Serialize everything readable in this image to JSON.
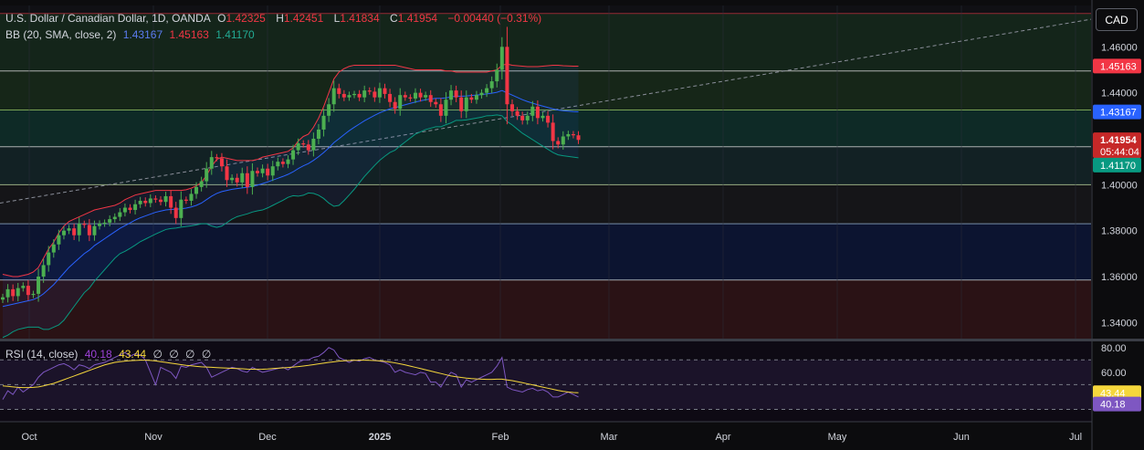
{
  "header": {
    "symbol": "U.S. Dollar / Canadian Dollar, 1D, OANDA",
    "open_label": "O",
    "open": "1.42325",
    "high_label": "H",
    "high": "1.42451",
    "low_label": "L",
    "low": "1.41834",
    "close_label": "C",
    "close": "1.41954",
    "change": "−0.00440 (−0.31%)"
  },
  "bb_legend": {
    "label": "BB (20, SMA, close, 2)",
    "basis": "1.43167",
    "upper": "1.45163",
    "lower": "1.41170"
  },
  "rsi_legend": {
    "label": "RSI (14, close)",
    "rsi": "40.18",
    "ma": "43.44",
    "extras": [
      "∅",
      "∅",
      "∅",
      "∅"
    ]
  },
  "currency_button": "CAD",
  "price_badges": {
    "upper": "1.45163",
    "basis": "1.43167",
    "last": "1.41954",
    "countdown": "05:44:04",
    "lower": "1.41170"
  },
  "rsi_badges": {
    "ma": "43.44",
    "rsi": "40.18"
  },
  "colors": {
    "up": "#4caf50",
    "down": "#f23645",
    "bb_upper": "#f23645",
    "bb_basis": "#2962ff",
    "bb_lower": "#089981",
    "rsi": "#7e57c2",
    "rsi_ma": "#f5d73c"
  },
  "chart_data": [
    {
      "type": "candlestick",
      "title": "U.S. Dollar / Canadian Dollar, 1D, OANDA",
      "x_ticks": [
        "Oct",
        "Nov",
        "Dec",
        "2025",
        "Feb",
        "Mar",
        "Apr",
        "May",
        "Jun",
        "Jul"
      ],
      "y_ticks": [
        "1.46000",
        "1.44000",
        "1.40000",
        "1.38000",
        "1.36000",
        "1.34000"
      ],
      "ylim": [
        1.333,
        1.478
      ],
      "levels": [
        1.4745,
        1.4495,
        1.4325,
        1.4165,
        1.4,
        1.383,
        1.3585
      ],
      "closes": [
        1.351,
        1.3545,
        1.3515,
        1.355,
        1.356,
        1.352,
        1.3525,
        1.36,
        1.365,
        1.3705,
        1.374,
        1.378,
        1.38,
        1.381,
        1.378,
        1.383,
        1.3825,
        1.378,
        1.382,
        1.383,
        1.3835,
        1.385,
        1.386,
        1.388,
        1.39,
        1.389,
        1.3915,
        1.393,
        1.392,
        1.394,
        1.3935,
        1.3925,
        1.395,
        1.39,
        1.3855,
        1.3935,
        1.393,
        1.396,
        1.399,
        1.4015,
        1.407,
        1.412,
        1.4115,
        1.408,
        1.402,
        1.403,
        1.401,
        1.405,
        1.399,
        1.406,
        1.405,
        1.407,
        1.404,
        1.408,
        1.41,
        1.409,
        1.411,
        1.415,
        1.418,
        1.4175,
        1.415,
        1.42,
        1.424,
        1.43,
        1.435,
        1.442,
        1.4395,
        1.438,
        1.439,
        1.4395,
        1.438,
        1.441,
        1.4405,
        1.438,
        1.442,
        1.4395,
        1.436,
        1.433,
        1.439,
        1.438,
        1.4375,
        1.44,
        1.438,
        1.439,
        1.436,
        1.435,
        1.43,
        1.437,
        1.441,
        1.438,
        1.432,
        1.438,
        1.437,
        1.439,
        1.44,
        1.442,
        1.445,
        1.45,
        1.46,
        1.435,
        1.432,
        1.43,
        1.428,
        1.43,
        1.434,
        1.429,
        1.43,
        1.427,
        1.419,
        1.4175,
        1.421,
        1.422,
        1.4215,
        1.4195
      ],
      "bb_upper": [
        1.361,
        1.3605,
        1.36,
        1.36,
        1.3605,
        1.361,
        1.362,
        1.364,
        1.368,
        1.372,
        1.375,
        1.379,
        1.382,
        1.384,
        1.385,
        1.386,
        1.387,
        1.388,
        1.389,
        1.3895,
        1.39,
        1.3905,
        1.391,
        1.392,
        1.3935,
        1.3945,
        1.3955,
        1.396,
        1.3965,
        1.397,
        1.3975,
        1.3975,
        1.3975,
        1.3975,
        1.3975,
        1.3975,
        1.3978,
        1.3985,
        1.3995,
        1.401,
        1.404,
        1.408,
        1.411,
        1.412,
        1.4115,
        1.411,
        1.4105,
        1.4105,
        1.4105,
        1.4105,
        1.411,
        1.412,
        1.4125,
        1.413,
        1.4135,
        1.414,
        1.4145,
        1.416,
        1.419,
        1.421,
        1.422,
        1.425,
        1.429,
        1.434,
        1.44,
        1.446,
        1.449,
        1.4505,
        1.4515,
        1.452,
        1.452,
        1.452,
        1.452,
        1.452,
        1.452,
        1.452,
        1.452,
        1.452,
        1.4515,
        1.451,
        1.4505,
        1.45,
        1.45,
        1.45,
        1.45,
        1.45,
        1.45,
        1.4495,
        1.4495,
        1.449,
        1.449,
        1.449,
        1.449,
        1.449,
        1.449,
        1.449,
        1.4495,
        1.45,
        1.452,
        1.4525,
        1.452,
        1.4518,
        1.4516,
        1.4514,
        1.4514,
        1.4514,
        1.4516,
        1.4518,
        1.452,
        1.452,
        1.4518,
        1.4517,
        1.4516,
        1.4516
      ],
      "bb_basis": [
        1.347,
        1.3475,
        1.348,
        1.3485,
        1.349,
        1.3495,
        1.35,
        1.351,
        1.3525,
        1.3545,
        1.3565,
        1.359,
        1.3615,
        1.364,
        1.366,
        1.368,
        1.37,
        1.3715,
        1.3735,
        1.375,
        1.3765,
        1.378,
        1.3795,
        1.381,
        1.3822,
        1.3834,
        1.3846,
        1.3856,
        1.3864,
        1.3872,
        1.388,
        1.3885,
        1.389,
        1.3892,
        1.3893,
        1.3895,
        1.3898,
        1.3903,
        1.391,
        1.392,
        1.3935,
        1.395,
        1.3962,
        1.397,
        1.3975,
        1.398,
        1.3983,
        1.3986,
        1.3989,
        1.3993,
        1.3998,
        1.4005,
        1.4012,
        1.402,
        1.4028,
        1.4036,
        1.4045,
        1.4056,
        1.407,
        1.4082,
        1.4092,
        1.4106,
        1.4122,
        1.414,
        1.416,
        1.4183,
        1.42,
        1.4218,
        1.4235,
        1.425,
        1.4264,
        1.4278,
        1.429,
        1.4302,
        1.4313,
        1.4322,
        1.433,
        1.4335,
        1.4342,
        1.4348,
        1.4354,
        1.436,
        1.4365,
        1.437,
        1.4373,
        1.4376,
        1.4376,
        1.4378,
        1.4382,
        1.4385,
        1.4385,
        1.4386,
        1.4388,
        1.439,
        1.4392,
        1.4395,
        1.4398,
        1.4402,
        1.441,
        1.44,
        1.439,
        1.438,
        1.437,
        1.4362,
        1.4355,
        1.4348,
        1.4342,
        1.4336,
        1.433,
        1.4325,
        1.4322,
        1.432,
        1.4318,
        1.4317
      ],
      "bb_lower": [
        1.3335,
        1.3345,
        1.336,
        1.337,
        1.3375,
        1.338,
        1.338,
        1.338,
        1.337,
        1.337,
        1.338,
        1.339,
        1.341,
        1.344,
        1.347,
        1.35,
        1.353,
        1.355,
        1.358,
        1.3605,
        1.363,
        1.3655,
        1.368,
        1.37,
        1.371,
        1.3723,
        1.3737,
        1.3752,
        1.3763,
        1.3774,
        1.3785,
        1.3795,
        1.3805,
        1.3809,
        1.3811,
        1.3815,
        1.3818,
        1.3821,
        1.3825,
        1.383,
        1.383,
        1.382,
        1.3814,
        1.382,
        1.3835,
        1.385,
        1.3861,
        1.3867,
        1.3873,
        1.3881,
        1.3886,
        1.389,
        1.3899,
        1.391,
        1.3921,
        1.3932,
        1.3945,
        1.3952,
        1.395,
        1.3954,
        1.3964,
        1.3962,
        1.3954,
        1.394,
        1.392,
        1.3906,
        1.391,
        1.3931,
        1.3955,
        1.398,
        1.4008,
        1.4036,
        1.406,
        1.4084,
        1.4106,
        1.4124,
        1.414,
        1.415,
        1.4169,
        1.4186,
        1.4203,
        1.422,
        1.423,
        1.424,
        1.4246,
        1.4252,
        1.4252,
        1.4261,
        1.4269,
        1.428,
        1.428,
        1.4282,
        1.4286,
        1.429,
        1.4294,
        1.43,
        1.4301,
        1.4304,
        1.43,
        1.4275,
        1.426,
        1.4242,
        1.4224,
        1.421,
        1.4196,
        1.4182,
        1.4168,
        1.4154,
        1.414,
        1.413,
        1.4126,
        1.4123,
        1.412,
        1.4117
      ]
    },
    {
      "type": "line",
      "title": "RSI (14, close)",
      "y_ticks": [
        "80.00",
        "60.00"
      ],
      "ylim": [
        20,
        85
      ],
      "bands": [
        70,
        50,
        30
      ],
      "series": [
        {
          "name": "RSI",
          "values": [
            38,
            45,
            42,
            48,
            44,
            47,
            50,
            56,
            60,
            62,
            64,
            66,
            67,
            65,
            62,
            66,
            65,
            63,
            66,
            67,
            68,
            70,
            72,
            74,
            76,
            73,
            75,
            74,
            70,
            60,
            50,
            64,
            62,
            60,
            55,
            65,
            64,
            66,
            67,
            68,
            64,
            56,
            58,
            60,
            62,
            64,
            63,
            61,
            60,
            64,
            62,
            60,
            61,
            62,
            63,
            64,
            62,
            65,
            68,
            70,
            70,
            72,
            73,
            76,
            80,
            78,
            72,
            70,
            68,
            70,
            69,
            71,
            72,
            70,
            69,
            68,
            66,
            60,
            62,
            60,
            59,
            58,
            60,
            59,
            52,
            52,
            48,
            55,
            60,
            58,
            48,
            54,
            52,
            54,
            56,
            58,
            60,
            65,
            72,
            48,
            46,
            45,
            44,
            46,
            47,
            45,
            46,
            44,
            40,
            40,
            42,
            44,
            42,
            40
          ]
        },
        {
          "name": "RSI-based MA",
          "values": [
            49,
            48.6,
            48.2,
            47.8,
            47.6,
            47.6,
            47.8,
            48.2,
            49,
            50,
            51,
            52.5,
            54,
            55.5,
            57,
            58.5,
            60,
            61.5,
            63,
            64.5,
            66,
            67,
            68,
            68.6,
            69,
            69.4,
            69.6,
            69.8,
            69.8,
            69.6,
            69.2,
            68.6,
            68,
            67.4,
            66.8,
            66.2,
            65.6,
            65.2,
            64.8,
            64.4,
            64.2,
            64,
            63.8,
            63.6,
            63.4,
            63.2,
            63,
            62.8,
            62.6,
            62.5,
            62.4,
            62.5,
            62.7,
            63,
            63.3,
            63.6,
            63.9,
            64.2,
            64.6,
            65.1,
            65.6,
            66.2,
            66.8,
            67.4,
            68,
            68.5,
            69,
            69.3,
            69.5,
            69.7,
            69.8,
            69.8,
            69.7,
            69.5,
            69.2,
            68.8,
            68.3,
            67.6,
            66.8,
            66,
            65,
            64,
            63,
            62,
            61,
            60,
            59,
            58,
            57,
            56.4,
            55.8,
            55.3,
            54.9,
            54.6,
            54.4,
            54.3,
            54.3,
            54.4,
            54.4,
            53.8,
            53.2,
            52.4,
            51.6,
            50.7,
            49.8,
            48.9,
            48,
            47.1,
            46.2,
            45.3,
            44.6,
            44,
            43.6,
            43.44
          ]
        }
      ]
    }
  ]
}
